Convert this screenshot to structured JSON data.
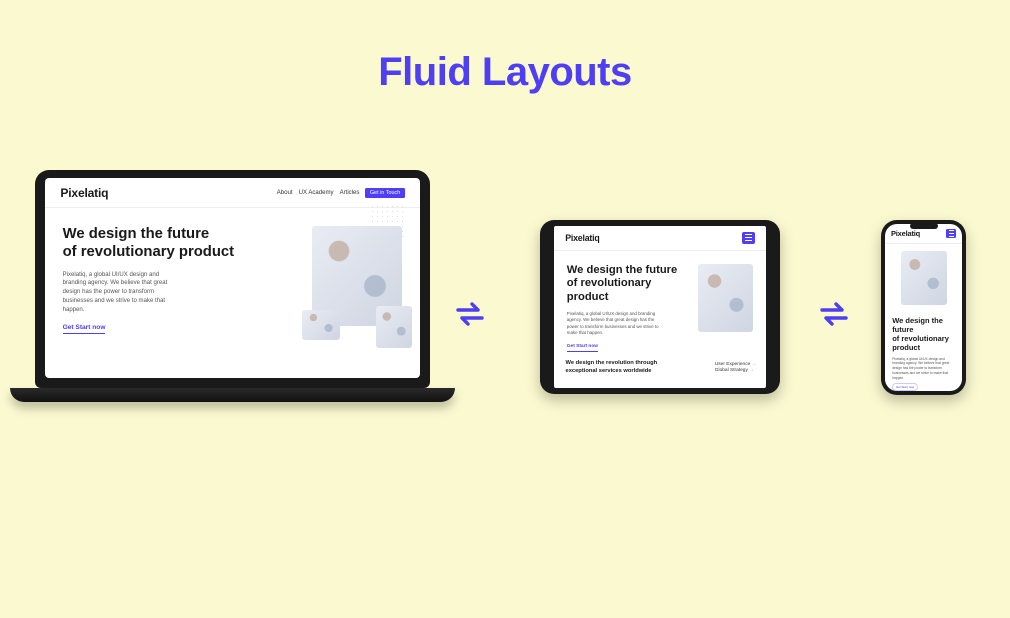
{
  "title": "Fluid Layouts",
  "site": {
    "brand": "Pixelatiq",
    "nav": {
      "about": "About",
      "academy": "UX Academy",
      "articles": "Articles",
      "cta": "Get in Touch"
    },
    "hero": {
      "h1_l1": "We design the future",
      "h1_l2": "of revolutionary product",
      "h1_tablet_l1": "We design the future",
      "h1_tablet_l2": "of revolutionary",
      "h1_tablet_l3": "product",
      "body": "Pixelatiq, a global UI/UX design and branding agency. We believe that great design has the power to transform businesses and we strive to make that happen.",
      "cta_link": "Get Start now"
    },
    "section2": {
      "heading_l1": "We design the revolution through",
      "heading_l2": "exceptional services worldwide",
      "features": {
        "f1": "User Experience",
        "f2": "Global Strategy"
      }
    }
  }
}
